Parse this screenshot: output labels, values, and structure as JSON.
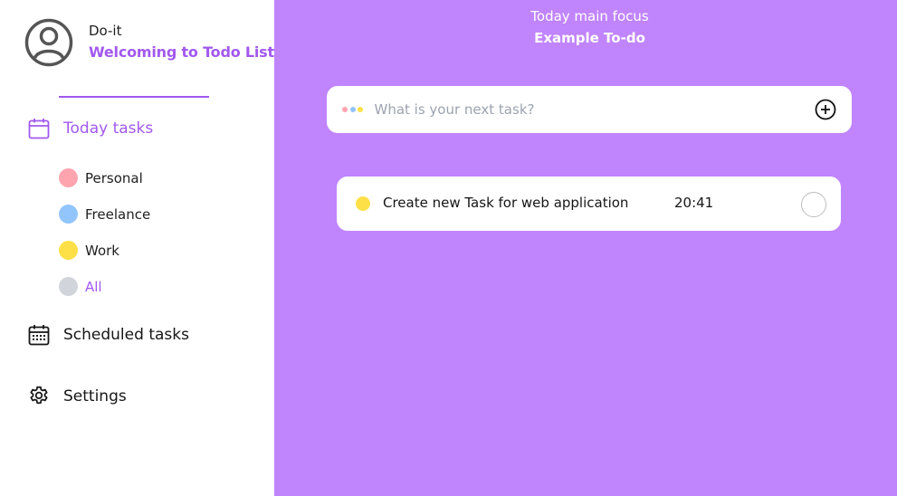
{
  "profile": {
    "name": "Do-it",
    "welcome": "Welcoming to Todo List",
    "avatar_icon": "user-circle-icon"
  },
  "nav": {
    "today": {
      "label": "Today tasks",
      "icon": "calendar-icon",
      "color": "#a259ee"
    },
    "scheduled": {
      "label": "Scheduled tasks",
      "icon": "calendar-grid-icon"
    },
    "settings": {
      "label": "Settings",
      "icon": "gear-icon"
    }
  },
  "categories": [
    {
      "label": "Personal",
      "color": "#fda4af"
    },
    {
      "label": "Freelance",
      "color": "#93c5fd"
    },
    {
      "label": "Work",
      "color": "#fde047"
    },
    {
      "label": "All",
      "color": "#d1d5db"
    }
  ],
  "main": {
    "focus_title": "Today main focus",
    "focus_subtitle": "Example To-do",
    "background": "#c084fc",
    "input": {
      "placeholder": "What is your next task?",
      "value": "",
      "dot_colors": [
        "#fda4af",
        "#93c5fd",
        "#fde047"
      ],
      "add_icon": "plus-circle-icon"
    },
    "tasks": [
      {
        "text": "Create new Task for web application",
        "time": "20:41",
        "color": "#fde047",
        "done": false
      }
    ]
  },
  "colors": {
    "accent": "#a259ee",
    "sidebar_bg": "#ffffff"
  }
}
